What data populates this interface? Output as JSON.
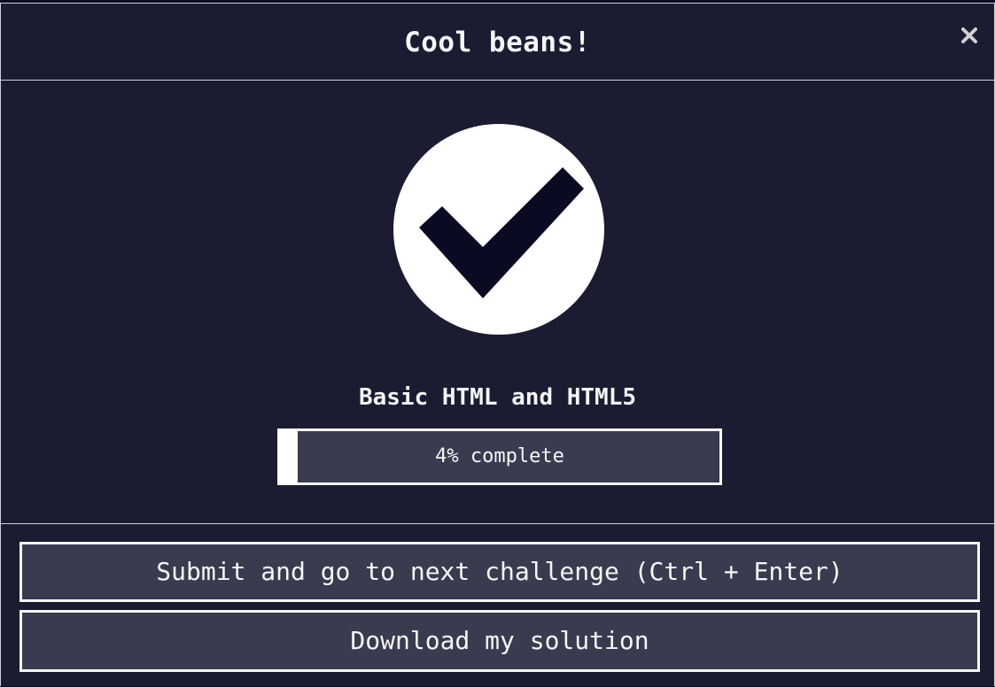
{
  "modal": {
    "title": "Cool beans!",
    "close_icon": "close-icon"
  },
  "success": {
    "icon": "checkmark-icon",
    "block_title": "Basic HTML and HTML5",
    "progress_percent": 4,
    "progress_label": "4% complete"
  },
  "actions": {
    "submit_label": "Submit and go to next challenge (Ctrl + Enter)",
    "download_label": "Download my solution"
  },
  "colors": {
    "background": "#1b1b32",
    "button_bg": "#3b3b4f",
    "foreground": "#f5f6f7",
    "check": "#0a0a23"
  }
}
